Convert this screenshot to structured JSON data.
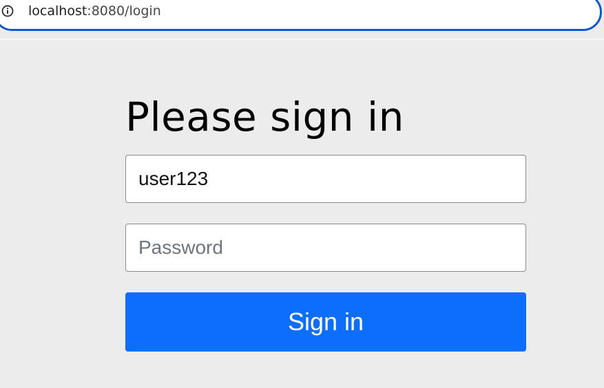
{
  "browser": {
    "url_host": "localhost",
    "url_rest": ":8080/login",
    "info_icon": "info-circle-icon"
  },
  "login_form": {
    "heading": "Please sign in",
    "username_value": "user123",
    "password_placeholder": "Password",
    "submit_label": "Sign in"
  },
  "colors": {
    "accent": "#0d6efd",
    "address_bar_border": "#0b57d0",
    "page_background": "#ececec"
  }
}
